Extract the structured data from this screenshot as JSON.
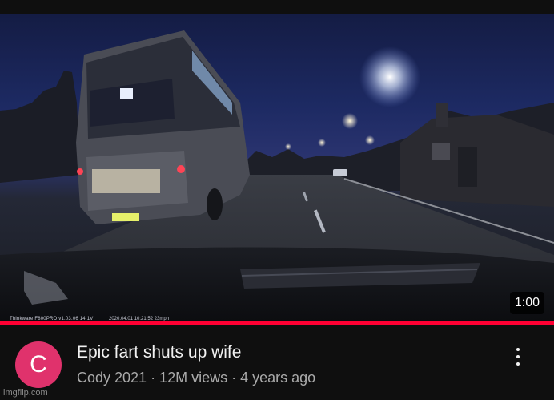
{
  "video": {
    "duration": "1:00",
    "progress_fraction": 1.0,
    "title": "Epic fart shuts up wife",
    "subtitle": "Cody 2021 · 12M views · 4 years ago",
    "dashcam_stamp": "Thinkware F800PRO   v1.03.06   14.1V",
    "dashcam_time": "2020.04.01 10:21:52     23mph"
  },
  "channel": {
    "avatar_letter": "C",
    "avatar_color": "#e0326c"
  },
  "menu": {
    "icon": "more-vertical-icon"
  },
  "watermark": "imgflip.com",
  "colors": {
    "background": "#0f0f0f",
    "progress": "#ff0033",
    "title": "#f1f1f1",
    "subtitle": "#aaaaaa"
  }
}
